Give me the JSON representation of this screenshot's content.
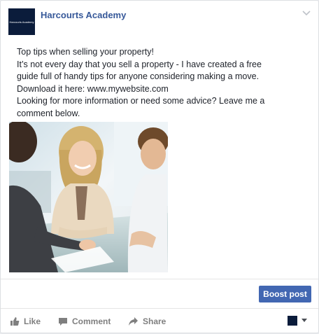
{
  "page": {
    "name": "Harcourts Academy",
    "avatar_text": "Harcourts Academy"
  },
  "post": {
    "lines": [
      "Top tips when selling your property!",
      "It’s not every day that you sell a property - I have created a free",
      "guide full of handy tips for anyone considering making a move.",
      "Download it here: www.mywebsite.com",
      "Looking for more information or need some advice? Leave me a",
      "comment below."
    ]
  },
  "boost": {
    "label": "Boost post"
  },
  "actions": {
    "like": "Like",
    "comment": "Comment",
    "share": "Share"
  },
  "icons": {
    "chevron": "chevron-down-icon",
    "like": "thumbs-up-icon",
    "comment": "comment-bubble-icon",
    "share": "share-arrow-icon",
    "selector_caret": "caret-down-icon"
  },
  "colors": {
    "page_name": "#365899",
    "boost_button": "#4267b2",
    "avatar_bg": "#0b1c3b",
    "action_text": "#7f7f7f"
  }
}
